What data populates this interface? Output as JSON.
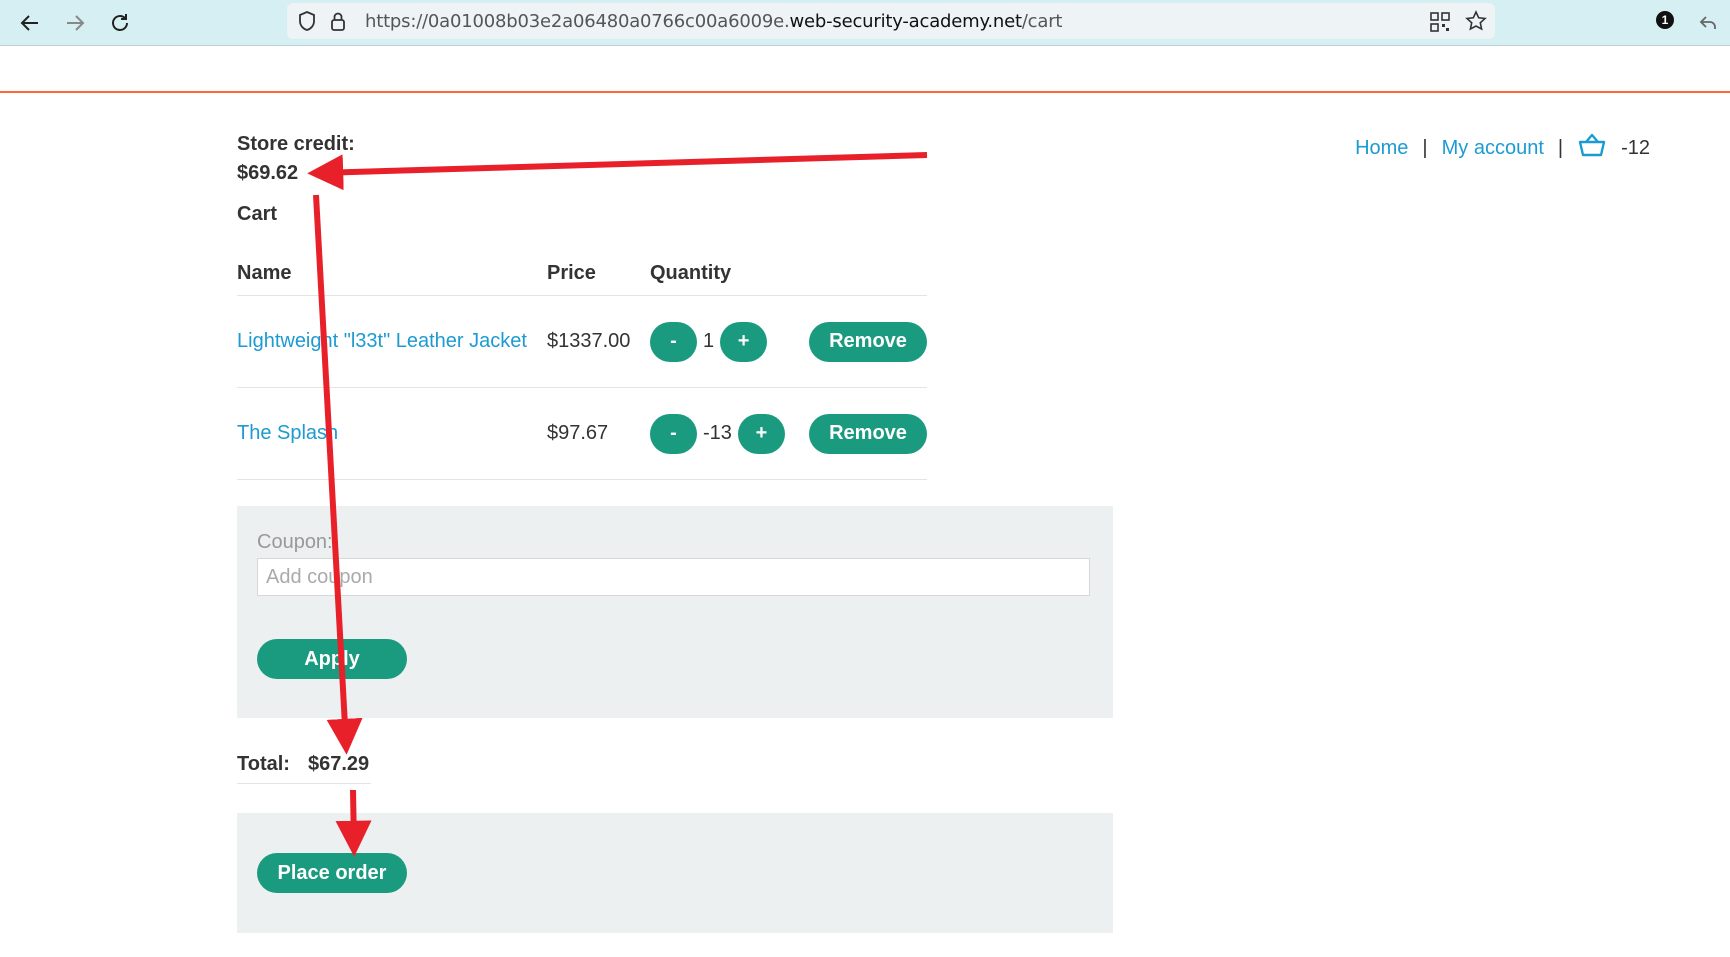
{
  "browser": {
    "url_prefix": "https://0a01008b03e2a06480a0766c00a6009e.",
    "url_host": "web-security-academy.net",
    "url_path": "/cart",
    "badge_count": "1"
  },
  "header": {
    "nav_home": "Home",
    "nav_separator": "|",
    "nav_account": "My account",
    "cart_count": "-12"
  },
  "store_credit": {
    "label": "Store credit:",
    "value": "$69.62"
  },
  "cart": {
    "title": "Cart",
    "columns": [
      "Name",
      "Price",
      "Quantity"
    ],
    "rows": [
      {
        "name": "Lightweight \"l33t\" Leather Jacket",
        "price": "$1337.00",
        "quantity": "1",
        "decrement": "-",
        "increment": "+",
        "remove": "Remove"
      },
      {
        "name": "The Splash",
        "price": "$97.67",
        "quantity": "-13",
        "decrement": "-",
        "increment": "+",
        "remove": "Remove"
      }
    ]
  },
  "coupon": {
    "label": "Coupon:",
    "placeholder": "Add coupon",
    "apply": "Apply"
  },
  "total": {
    "label": "Total:",
    "value": "$67.29"
  },
  "order": {
    "place_order": "Place order"
  },
  "colors": {
    "accent_line": "#ff6633",
    "button": "#1a9a7e",
    "link": "#1c9bd2",
    "annotation_arrow": "#e8202a"
  },
  "icons": [
    "back-arrow-icon",
    "forward-arrow-icon",
    "reload-icon",
    "shield-icon",
    "lock-icon",
    "qr-code-icon",
    "star-icon",
    "notification-badge-icon",
    "share-icon",
    "basket-icon"
  ]
}
